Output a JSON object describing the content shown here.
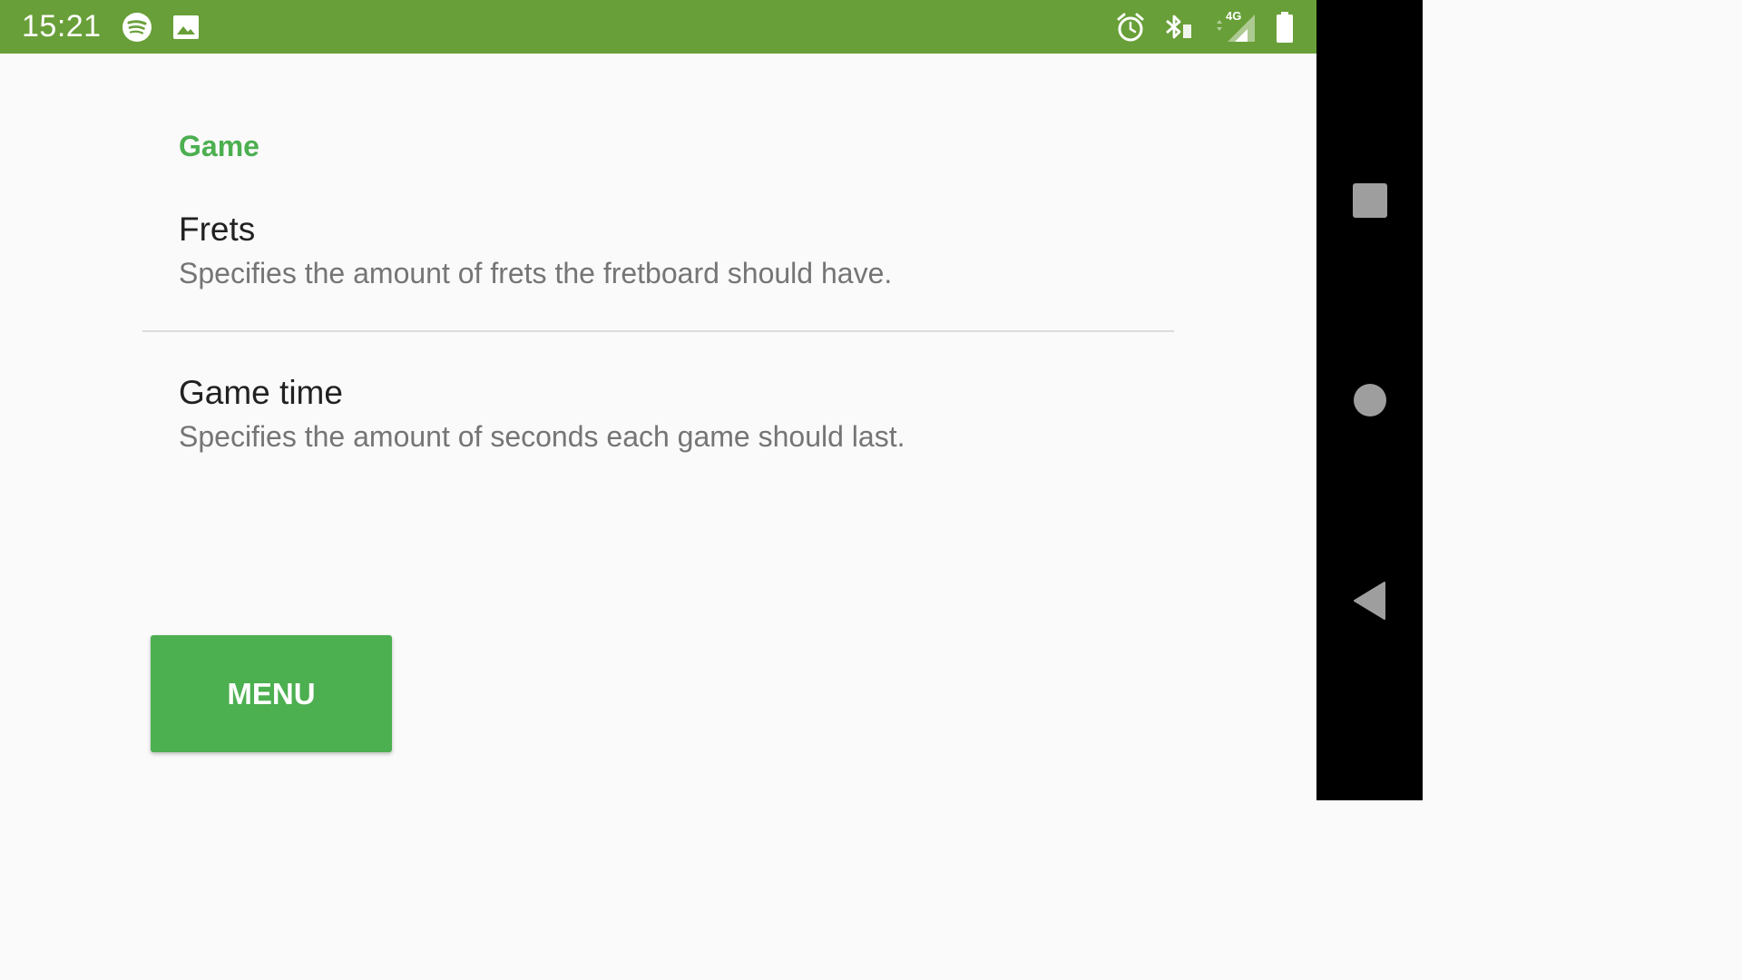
{
  "status_bar": {
    "time": "15:21",
    "network_label": "4G",
    "icons_left": [
      "spotify-icon",
      "image-icon"
    ],
    "icons_right": [
      "alarm-icon",
      "bluetooth-icon",
      "signal-icon",
      "battery-icon"
    ],
    "background_color": "#689f38"
  },
  "preferences": {
    "category_title": "Game",
    "items": [
      {
        "title": "Frets",
        "summary": "Specifies the amount of frets the fretboard should have."
      },
      {
        "title": "Game time",
        "summary": "Specifies the amount of seconds each game should last."
      }
    ],
    "accent_color": "#4caf50"
  },
  "actions": {
    "menu_label": "MENU"
  },
  "nav_bar": {
    "buttons": [
      "recents-icon",
      "home-icon",
      "back-icon"
    ]
  }
}
